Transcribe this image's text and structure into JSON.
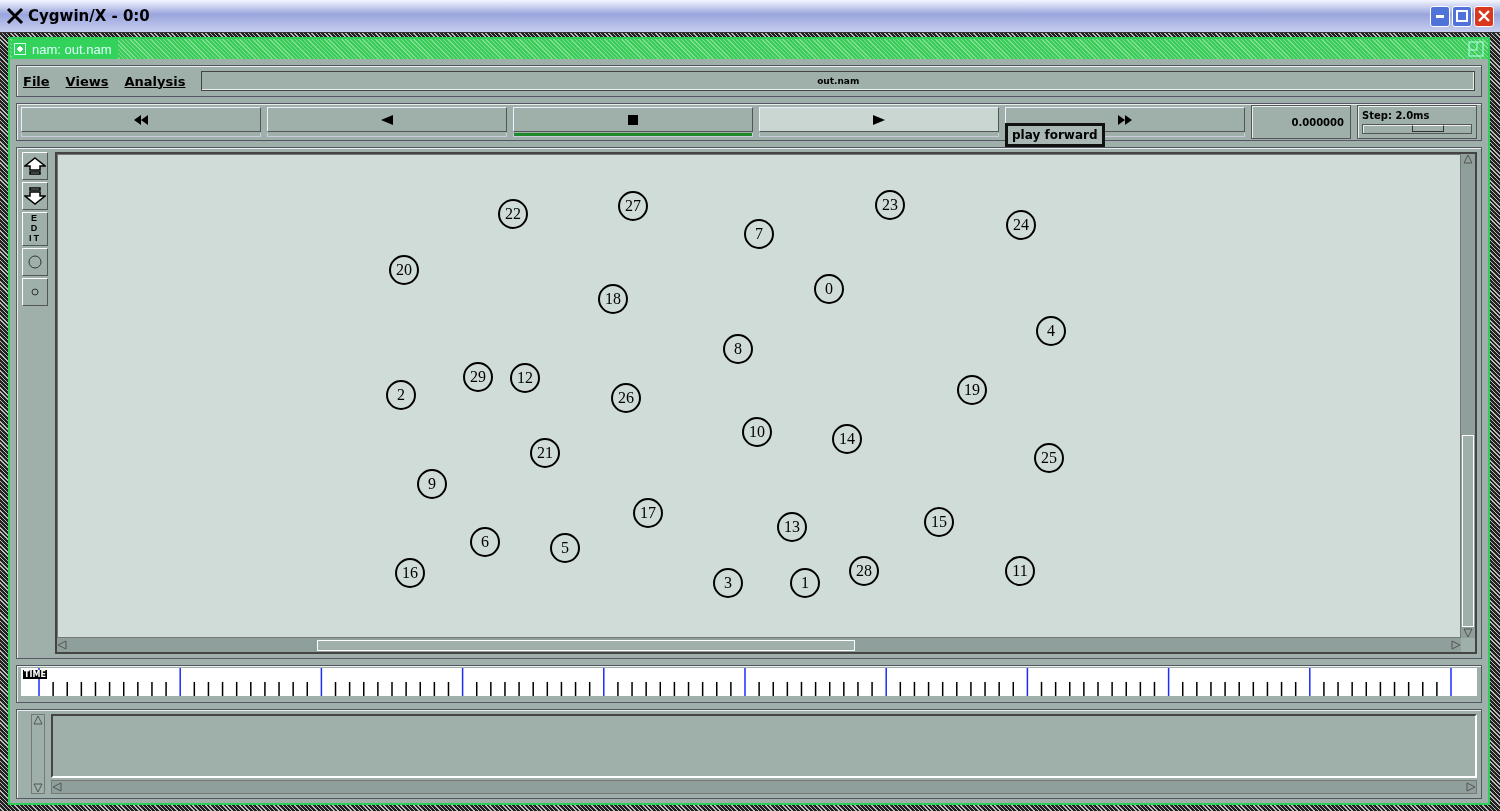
{
  "window": {
    "title": "Cygwin/X - 0:0"
  },
  "app_window": {
    "title": "nam: out.nam"
  },
  "menu": [
    {
      "label": "File"
    },
    {
      "label": "Views"
    },
    {
      "label": "Analysis"
    }
  ],
  "file_label": "out.nam",
  "transport": [
    {
      "kind": "rewind",
      "selected": false,
      "hovered": false
    },
    {
      "kind": "back",
      "selected": false,
      "hovered": false
    },
    {
      "kind": "stop",
      "selected": true,
      "hovered": false
    },
    {
      "kind": "play",
      "selected": false,
      "hovered": true
    },
    {
      "kind": "forward",
      "selected": false,
      "hovered": false
    }
  ],
  "tooltip": "play forward",
  "time": "0.000000",
  "step": {
    "label": "Step: 2.0ms",
    "level": 0.6
  },
  "tools": [
    {
      "kind": "zoom-in"
    },
    {
      "kind": "zoom-out"
    },
    {
      "kind": "edit",
      "label": "EDIT"
    },
    {
      "kind": "big-node"
    },
    {
      "kind": "small-node"
    }
  ],
  "nodes": [
    "22",
    "27",
    "7",
    "23",
    "24",
    "20",
    "18",
    "0",
    "4",
    "8",
    "2",
    "29",
    "12",
    "26",
    "19",
    "10",
    "14",
    "25",
    "21",
    "9",
    "17",
    "13",
    "15",
    "6",
    "5",
    "16",
    "3",
    "1",
    "28",
    "11"
  ],
  "timeline": {
    "label": "TIME"
  }
}
